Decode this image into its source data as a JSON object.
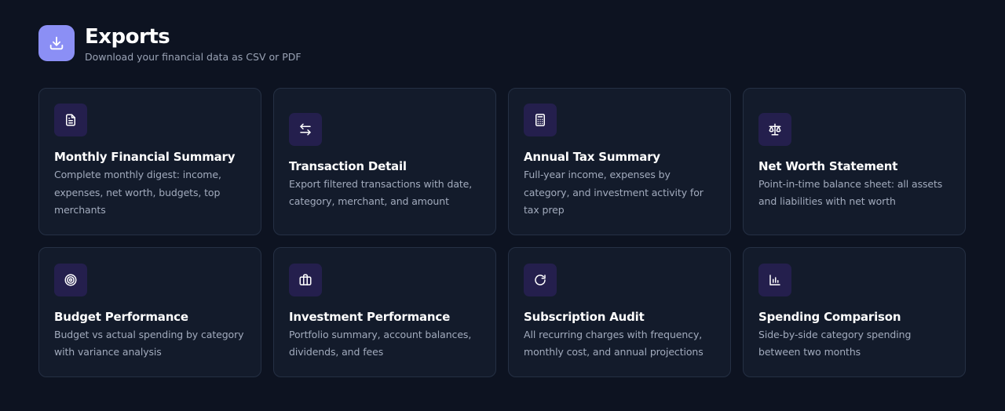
{
  "header": {
    "icon": "download-icon",
    "title": "Exports",
    "subtitle": "Download your financial data as CSV or PDF"
  },
  "colors": {
    "background": "#0d1321",
    "card_background": "#131b2b",
    "card_border": "#253044",
    "accent": "#8b8ff5",
    "icon_tile": "#241f4d"
  },
  "exports": [
    {
      "icon": "document-icon",
      "title": "Monthly Financial Summary",
      "description": "Complete monthly digest: income, expenses, net worth, budgets, top merchants"
    },
    {
      "icon": "arrows-left-right-icon",
      "title": "Transaction Detail",
      "description": "Export filtered transactions with date, category, merchant, and amount"
    },
    {
      "icon": "calculator-icon",
      "title": "Annual Tax Summary",
      "description": "Full-year income, expenses by category, and investment activity for tax prep"
    },
    {
      "icon": "scale-icon",
      "title": "Net Worth Statement",
      "description": "Point-in-time balance sheet: all assets and liabilities with net worth"
    },
    {
      "icon": "target-icon",
      "title": "Budget Performance",
      "description": "Budget vs actual spending by category with variance analysis"
    },
    {
      "icon": "briefcase-icon",
      "title": "Investment Performance",
      "description": "Portfolio summary, account balances, dividends, and fees"
    },
    {
      "icon": "refresh-icon",
      "title": "Subscription Audit",
      "description": "All recurring charges with frequency, monthly cost, and annual projections"
    },
    {
      "icon": "bar-chart-icon",
      "title": "Spending Comparison",
      "description": "Side-by-side category spending between two months"
    }
  ]
}
